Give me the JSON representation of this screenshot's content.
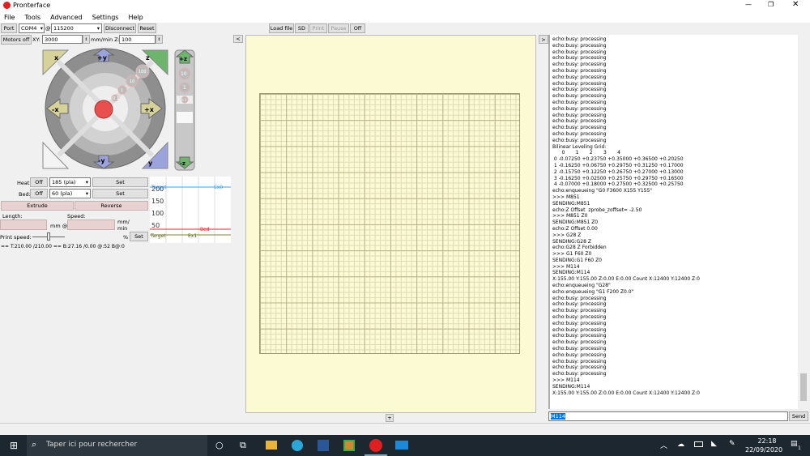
{
  "window": {
    "title": "Pronterface"
  },
  "menu": [
    "File",
    "Tools",
    "Advanced",
    "Settings",
    "Help"
  ],
  "toolbar": {
    "port_label": "Port",
    "port_value": "COM4",
    "at": "@",
    "baud_value": "115200",
    "disconnect": "Disconnect",
    "reset": "Reset",
    "motors_off": "Motors off",
    "xy_label": "XY:",
    "xy_value": "3000",
    "mmmin_z": "mm/min Z:",
    "z_value": "100",
    "load_file": "Load file",
    "sd": "SD",
    "print": "Print",
    "pause": "Pause",
    "off": "Off"
  },
  "jog": {
    "home_x": "x",
    "home_z": "z",
    "home_y": "y",
    "plus_y": "+y",
    "minus_y": "-y",
    "plus_x": "+x",
    "minus_x": "-x",
    "steps": [
      "100",
      "10",
      "1",
      "0.1"
    ],
    "plus_z": "+z",
    "minus_z": "-z",
    "z_steps": [
      "10",
      "1",
      "0.1"
    ]
  },
  "temps": {
    "heat_label": "Heat:",
    "heat_off": "Off",
    "heat_value": "185 (pla)",
    "heat_set": "Set",
    "bed_label": "Bed:",
    "bed_off": "Off",
    "bed_value": "60 (pla)",
    "bed_set": "Set",
    "extrude": "Extrude",
    "reverse": "Reverse",
    "length_label": "Length:",
    "speed_label": "Speed:",
    "mm_at": "mm @",
    "mm_min": "mm/\nmin",
    "print_speed_label": "Print speed:",
    "print_speed_fraction": 0.5,
    "percent": "%",
    "speed_set": "Set",
    "status": "== T:210.00 /210.00 == B:27.16 /0.00 @:52 B@:0"
  },
  "graph": {
    "ticks": [
      "200",
      "150",
      "100",
      "50"
    ],
    "labels": {
      "target": "Target",
      "ex0": "Ex0",
      "bed": "Bed",
      "target2": "Target",
      "ex1": "Ex1"
    },
    "colors": {
      "ex0": "#3aa0ff",
      "bed": "#ff2020",
      "ex1": "#808040"
    }
  },
  "console": {
    "lines_top_count": 17,
    "busy": "echo:busy: processing",
    "middle": [
      "Bilinear Leveling Grid:",
      "      0       1       2       3       4",
      " 0 -0.07250 +0.23750 +0.35000 +0.36500 +0.20250",
      " 1 -0.16250 +0.06750 +0.29750 +0.31250 +0.17000",
      " 2 -0.15750 +0.12250 +0.26750 +0.27000 +0.13000",
      " 3 -0.16250 +0.02500 +0.25750 +0.29750 +0.16500",
      " 4 -0.07000 +0.18000 +0.27500 +0.32500 +0.25750",
      "echo:enqueueing \"G0 F3600 X155 Y155\"",
      ">>> M851",
      "SENDING:M851",
      "echo:Z Offset  zprobe_zoffset= -2.50",
      ">>> M851 Z0",
      "SENDING:M851 Z0",
      "echo:Z Offset 0.00",
      ">>> G28 Z",
      "SENDING:G28 Z",
      "echo:G28 Z Forbidden",
      ">>> G1 F60 Z0",
      "SENDING:G1 F60 Z0",
      ">>> M114",
      "SENDING:M114",
      "X:155.00 Y:155.00 Z:0.00 E:0.00 Count X:12400 Y:12400 Z:0",
      "echo:enqueueing \"G28\"",
      "echo:enqueueing \"G1 F200 Z0.0\""
    ],
    "lines_bottom_count": 13,
    "end": [
      ">>> M114",
      "SENDING:M114",
      "X:155.00 Y:155.00 Z:0.00 E:0.00 Count X:12400 Y:12400 Z:0"
    ],
    "input_value": "M114",
    "send": "Send"
  },
  "panel": {
    "collapse_left": "<",
    "collapse_right": ">",
    "plus": "+"
  },
  "taskbar": {
    "search_placeholder": "Taper ici pour rechercher",
    "time": "22:18",
    "date": "22/09/2020",
    "notifications": "1"
  }
}
